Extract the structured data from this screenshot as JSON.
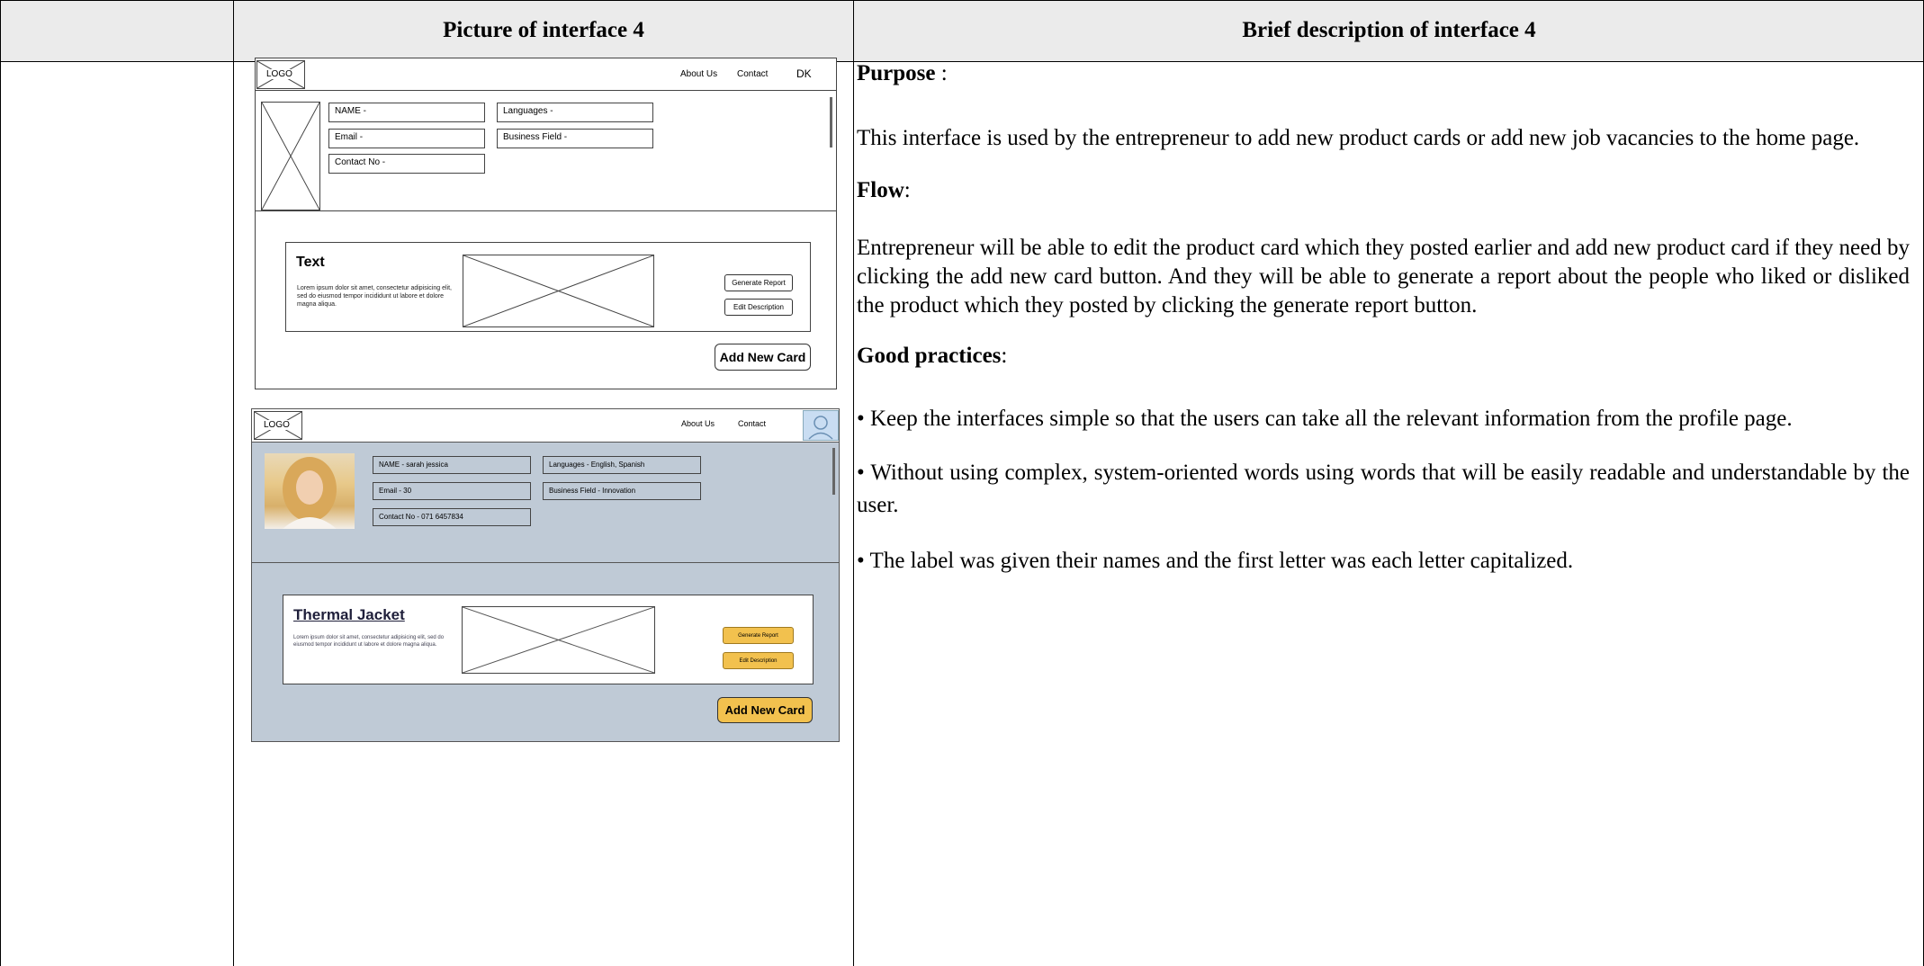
{
  "table": {
    "col1_header": "Picture of interface 4",
    "col2_header": "Brief description of interface 4"
  },
  "wireframe": {
    "logo": "LOGO",
    "nav_about": "About Us",
    "nav_contact": "Contact",
    "nav_initials": "DK",
    "name_field": "NAME -",
    "languages_field": "Languages -",
    "email_field": "Email -",
    "business_field": "Business Field -",
    "contact_field": "Contact No -",
    "card_title": "Text",
    "card_body": "Lorem ipsum dolor sit amet, consectetur adipisicing elit, sed do eiusmod tempor incididunt ut labore et dolore magna aliqua.",
    "generate_report": "Generate Report",
    "edit_description": "Edit Description",
    "add_new_card": "Add New Card"
  },
  "mockup": {
    "logo": "LOGO",
    "nav_about": "About Us",
    "nav_contact": "Contact",
    "name_field": "NAME -  sarah jessica",
    "languages_field": "Languages - English, Spanish",
    "email_field": "Email -  30",
    "business_field": "Business Field - Innovation",
    "contact_field": "Contact No -  071 6457834",
    "card_title": "Thermal Jacket",
    "card_body": "Lorem ipsum dolor sit amet, consectetur adipisicing elit, sed do eiusmod tempor incididunt ut labore et dolore magna aliqua.",
    "generate_report": "Generate Report",
    "edit_description": "Edit Description",
    "add_new_card": "Add New Card",
    "colors": {
      "panel": "#bfcad6",
      "button": "#f2c14e",
      "avatar": "#c9ddf2"
    }
  },
  "description": {
    "purpose_label": "Purpose",
    "purpose_suffix": " :",
    "purpose_text": "This interface is used by the entrepreneur to add new product cards or add new job vacancies to the home page.",
    "flow_label": "Flow",
    "flow_suffix": ":",
    "flow_text": "Entrepreneur will be able to edit the product card which they posted earlier and add new product card if they need by clicking the add new card button. And they will be able to generate a report about the people who liked or disliked the product which they posted by clicking the generate report button.",
    "good_label": "Good practices",
    "good_suffix": ":",
    "practice_1": "•  Keep the interfaces simple so that the users can take all the relevant information from the profile page.",
    "practice_2": "•  Without using complex, system-oriented words using words that will be easily readable and understandable by the user.",
    "practice_3": "• The label was given their names and the first letter was each letter capitalized."
  }
}
